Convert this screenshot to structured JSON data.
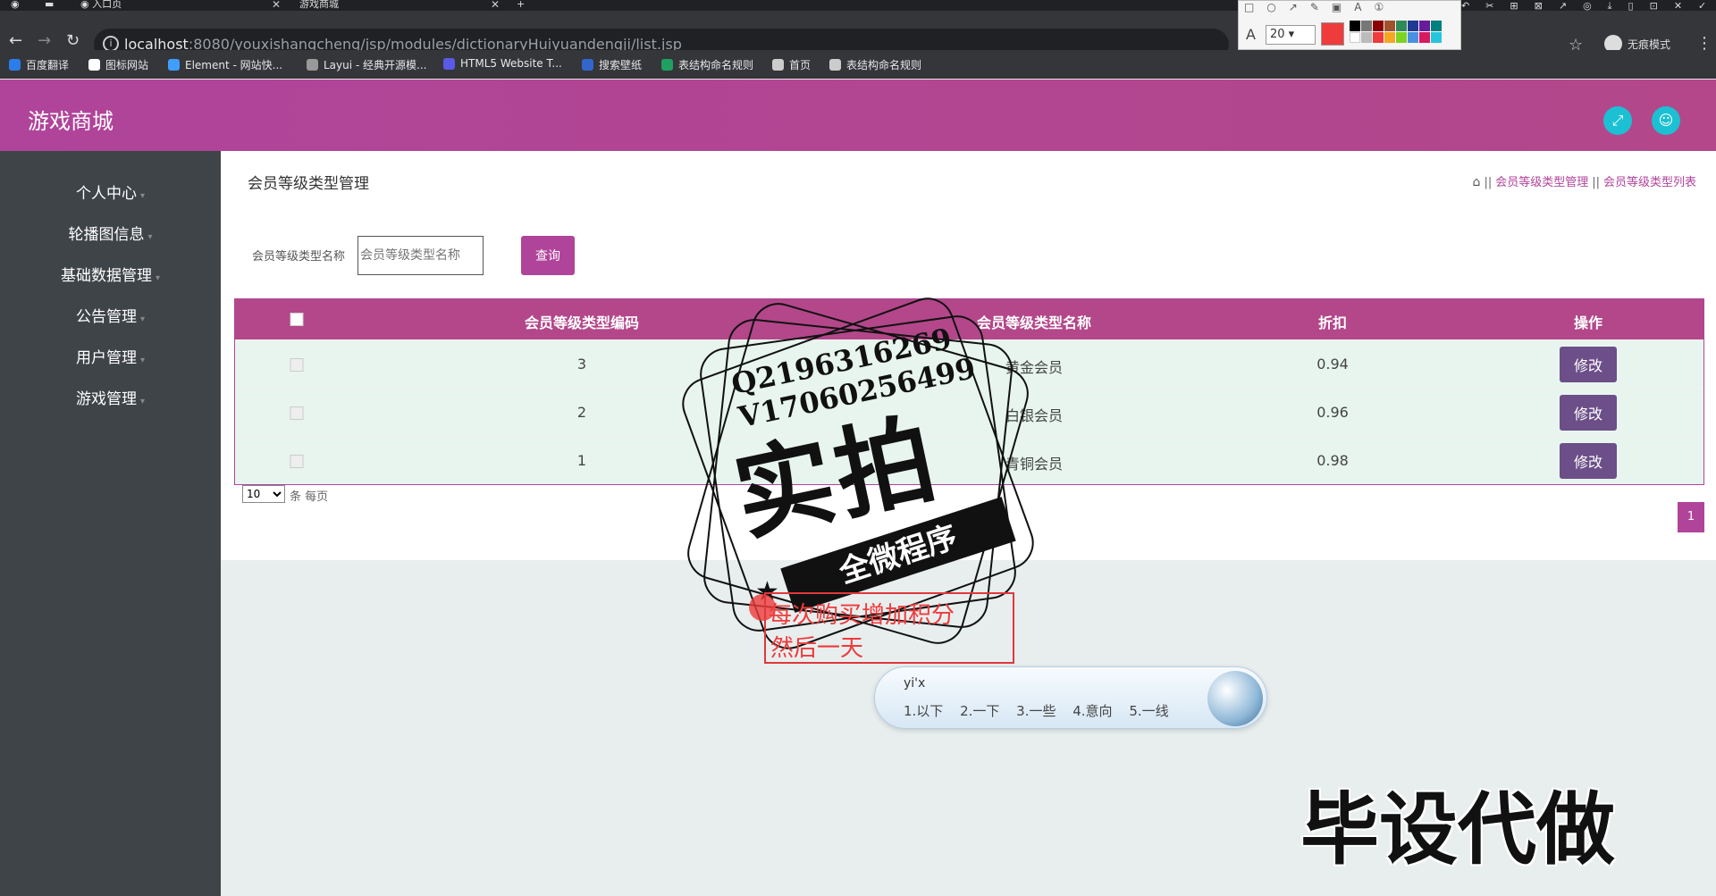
{
  "browser": {
    "tabs": [
      {
        "title": "入口页"
      },
      {
        "title": "游戏商城"
      }
    ],
    "url_host": "localhost",
    "url_path": ":8080/youxishangcheng/jsp/modules/dictionaryHuiyuandengji/list.jsp",
    "incognito_label": "无痕模式",
    "bookmarks": [
      {
        "label": "百度翻译",
        "color": "#2b7de9"
      },
      {
        "label": "图标网站",
        "color": "#ffffff"
      },
      {
        "label": "Element - 网站快...",
        "color": "#409eff"
      },
      {
        "label": "Layui - 经典开源模...",
        "color": "#999999"
      },
      {
        "label": "HTML5 Website T...",
        "color": "#5a5ae6"
      },
      {
        "label": "搜索壁纸",
        "color": "#3366cc"
      },
      {
        "label": "表结构命名规则",
        "color": "#20a060"
      },
      {
        "label": "首页",
        "color": "#cccccc"
      },
      {
        "label": "表结构命名规则",
        "color": "#cccccc"
      }
    ]
  },
  "annotation_toolbar": {
    "font_size": "20",
    "current_color": "#ee3b3b"
  },
  "app": {
    "title": "游戏商城"
  },
  "sidebar": {
    "items": [
      {
        "label": "个人中心"
      },
      {
        "label": "轮播图信息"
      },
      {
        "label": "基础数据管理"
      },
      {
        "label": "公告管理"
      },
      {
        "label": "用户管理"
      },
      {
        "label": "游戏管理"
      }
    ]
  },
  "page": {
    "title": "会员等级类型管理",
    "breadcrumb": [
      "会员等级类型管理",
      "会员等级类型列表"
    ],
    "search": {
      "label": "会员等级类型名称",
      "placeholder": "会员等级类型名称",
      "button": "查询"
    },
    "table": {
      "columns": [
        "会员等级类型编码",
        "会员等级类型名称",
        "折扣",
        "操作"
      ],
      "rows": [
        {
          "code": "3",
          "name": "黄金会员",
          "discount": "0.94",
          "action": "修改"
        },
        {
          "code": "2",
          "name": "白银会员",
          "discount": "0.96",
          "action": "修改"
        },
        {
          "code": "1",
          "name": "青铜会员",
          "discount": "0.98",
          "action": "修改"
        }
      ]
    },
    "pagination": {
      "page_size": "10",
      "page_size_label": "条 每页",
      "current_page": "1"
    }
  },
  "overlay": {
    "stamp_contact_1": "Q2196316269",
    "stamp_contact_2": "V17060256499",
    "stamp_main": "实拍",
    "stamp_ribbon": "全微程序",
    "annotation_line1": "每次购买增加积分",
    "annotation_line2": "然后一天",
    "ime_input": "yi'x",
    "ime_candidates": "1.以下 2.一下 3.一些 4.意向 5.一线",
    "big_text": "毕设代做"
  }
}
